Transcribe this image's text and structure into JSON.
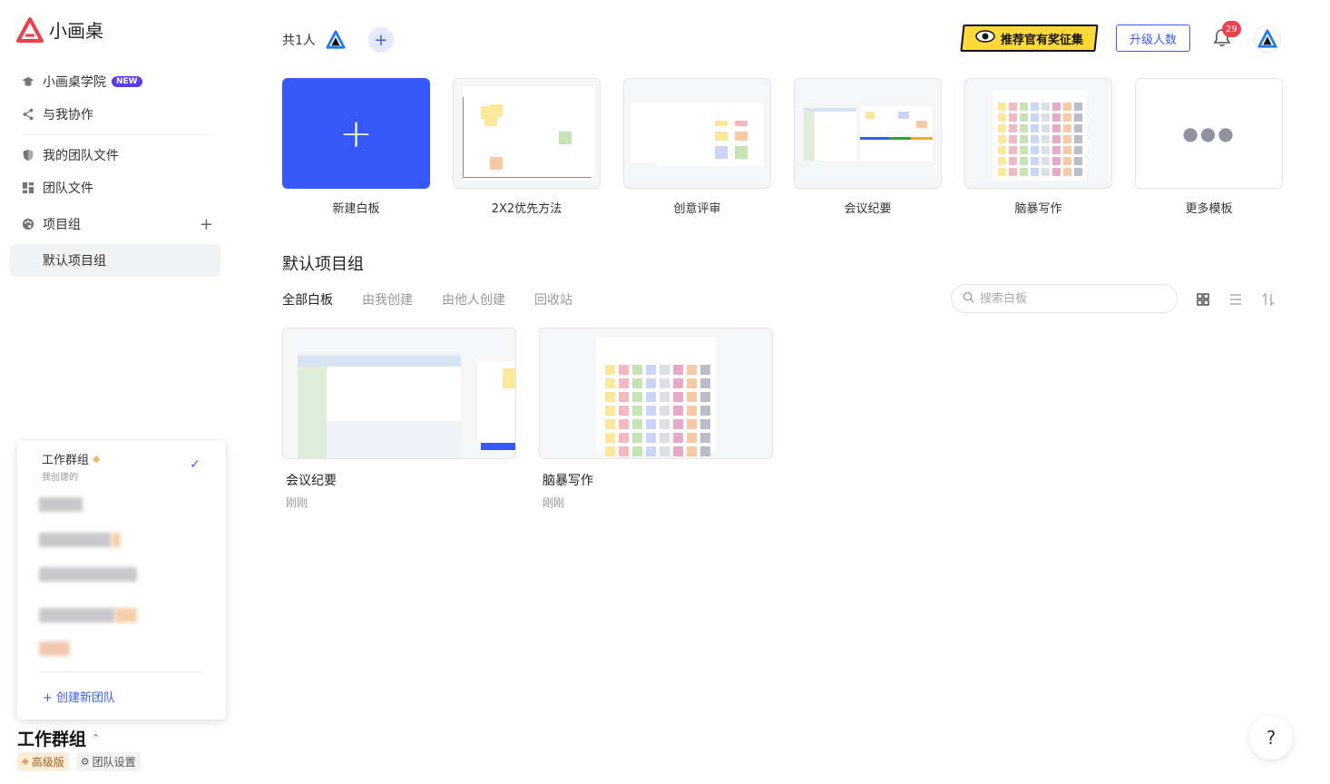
{
  "app": {
    "name": "小画桌"
  },
  "sidebar": {
    "items": [
      {
        "label": "小画桌学院",
        "badge": "NEW",
        "icon": "graduation-cap-icon"
      },
      {
        "label": "与我协作",
        "icon": "share-icon"
      },
      {
        "label": "我的团队文件",
        "icon": "shield-icon"
      },
      {
        "label": "团队文件",
        "icon": "grid-icon"
      },
      {
        "label": "项目组",
        "icon": "palette-icon"
      }
    ],
    "project_groups": [
      {
        "label": "默认项目组"
      }
    ]
  },
  "team_popup": {
    "current": {
      "name": "工作群组",
      "subtitle": "我创建的"
    },
    "create_label": "创建新团队"
  },
  "team": {
    "name": "工作群组",
    "plan_label": "高级版",
    "settings_label": "团队设置"
  },
  "header": {
    "members_label": "共1人",
    "promo_label": "推荐官有奖征集",
    "upgrade_label": "升级人数",
    "notification_count": "29"
  },
  "templates": [
    {
      "label": "新建白板",
      "kind": "new"
    },
    {
      "label": "2X2优先方法",
      "kind": "matrix"
    },
    {
      "label": "创意评审",
      "kind": "review"
    },
    {
      "label": "会议纪要",
      "kind": "meeting"
    },
    {
      "label": "脑暴写作",
      "kind": "brainstorm"
    },
    {
      "label": "更多模板",
      "kind": "more"
    }
  ],
  "section": {
    "title": "默认项目组",
    "tabs": [
      "全部白板",
      "由我创建",
      "由他人创建",
      "回收站"
    ],
    "active_tab": 0,
    "search_placeholder": "搜索白板"
  },
  "boards": [
    {
      "name": "会议纪要",
      "time": "刚刚",
      "thumb": "meeting"
    },
    {
      "name": "脑暴写作",
      "time": "刚刚",
      "thumb": "brainstorm"
    }
  ],
  "help_label": "?",
  "colors": {
    "accent": "#3758f9",
    "promo": "#ffd83a",
    "badge": "#f0404a"
  }
}
